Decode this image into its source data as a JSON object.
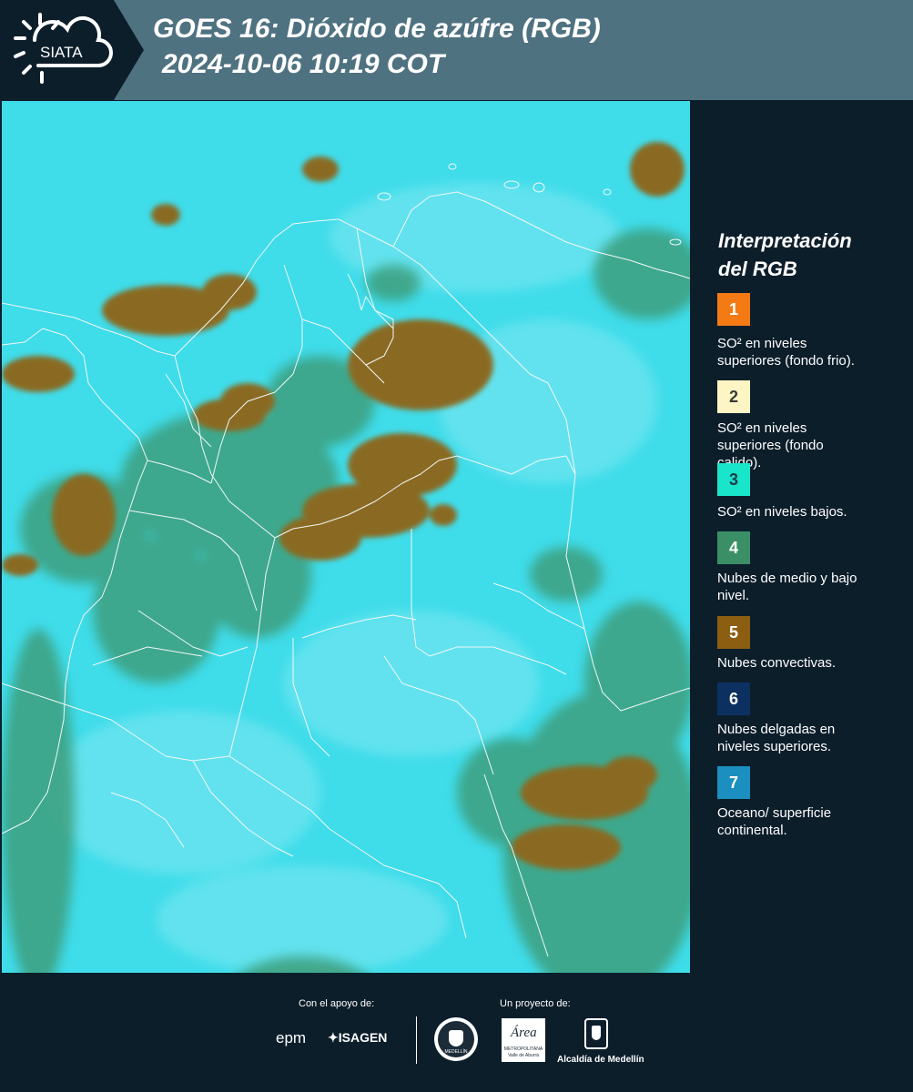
{
  "header": {
    "brand": "SIATA",
    "title_line1": "GOES 16: Dióxido de azúfre (RGB)",
    "title_line2": "2024-10-06 10:19 COT",
    "background_color": "#4f7281"
  },
  "legend": {
    "title_line1": "Interpretación",
    "title_line2": "del RGB",
    "items": [
      {
        "number": "1",
        "color": "#f47b14",
        "number_color": "#ffffff",
        "text_line1": "SO² en niveles",
        "text_line2": "superiores (fondo frio)."
      },
      {
        "number": "2",
        "color": "#fdf6c4",
        "number_color": "#3a3a3a",
        "text_line1": "SO² en niveles",
        "text_line2": "superiores (fondo",
        "text_line3": "calido)."
      },
      {
        "number": "3",
        "color": "#18e5c9",
        "number_color": "#1b3b4a",
        "text_line1": "SO² en niveles bajos."
      },
      {
        "number": "4",
        "color": "#3a8f66",
        "number_color": "#ffffff",
        "text_line1": "Nubes de medio y bajo",
        "text_line2": "nivel."
      },
      {
        "number": "5",
        "color": "#8b5e12",
        "number_color": "#ffffff",
        "text_line1": "Nubes convectivas."
      },
      {
        "number": "6",
        "color": "#0c3161",
        "number_color": "#ffffff",
        "text_line1": "Nubes delgadas en",
        "text_line2": "niveles superiores."
      },
      {
        "number": "7",
        "color": "#1b8fbf",
        "number_color": "#ffffff",
        "text_line1": "Oceano/ superficie",
        "text_line2": "continental."
      }
    ]
  },
  "footer": {
    "support_label": "Con el apoyo de:",
    "project_label": "Un proyecto de:",
    "sponsors": [
      "epm",
      "ISAGEN"
    ],
    "partners": {
      "seal_text": "MEDELLÍN",
      "area_name": "Área",
      "area_sub1": "METROPOLITANA",
      "area_sub2": "Valle de Aburrá",
      "alcaldia": "Alcaldía de Medellín"
    }
  },
  "map": {
    "colors": {
      "background": "#3fdcea",
      "convective": "#8a6a24",
      "midlow": "#3e9f7d",
      "borders": "#f2f7f8"
    }
  }
}
